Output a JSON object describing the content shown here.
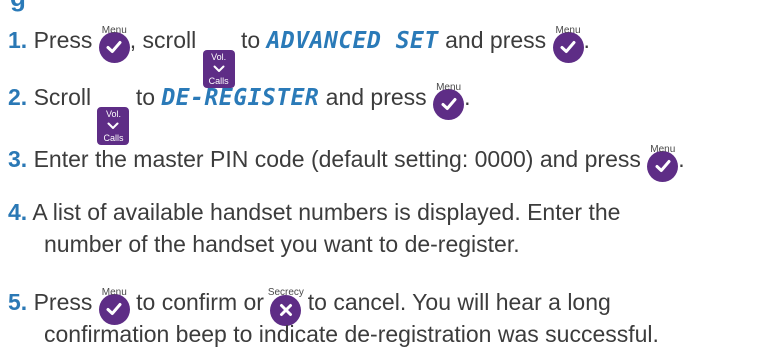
{
  "heading_fragment": "g",
  "keys": {
    "menu_caption": "Menu",
    "secrecy_caption": "Secrecy",
    "vol_top": "Vol.",
    "vol_bottom": "Calls"
  },
  "steps": [
    {
      "number": "1",
      "dot": ".",
      "t1": "Press",
      "t2": ", scroll",
      "t3": "to",
      "lcd": "ADVANCED SET",
      "t4": "and press",
      "t5": "."
    },
    {
      "number": "2",
      "dot": ".",
      "t1": "Scroll",
      "t2": "to",
      "lcd": "DE-REGISTER",
      "t3": "and press",
      "t4": "."
    },
    {
      "number": "3",
      "dot": ".",
      "t1": "Enter the master PIN code (default setting: 0000) and press",
      "t2": "."
    },
    {
      "number": "4",
      "dot": ".",
      "line1": "A list of available handset numbers is displayed. Enter the",
      "line2": "number of the handset you want to de-register."
    },
    {
      "number": "5",
      "dot": ".",
      "t1": "Press",
      "t2": "to confirm or",
      "t3": "to cancel. You will hear a long",
      "line2": "confirmation beep to indicate de-registration was successful."
    }
  ]
}
